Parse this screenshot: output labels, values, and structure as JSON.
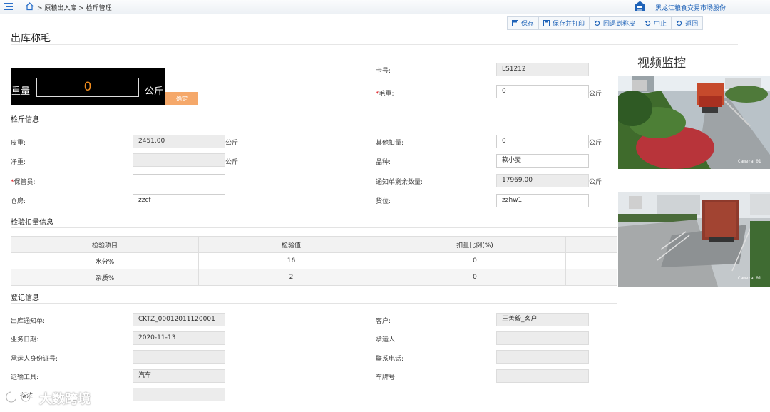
{
  "breadcrumb": {
    "text": "> 原粮出入库 > 检斤管理"
  },
  "brand": {
    "text": "黑龙江粮食交易市场股份"
  },
  "toolbar": {
    "save": "保存",
    "save_print": "保存并打印",
    "back_tare": "回退到称皮",
    "abort": "中止",
    "return": "返回"
  },
  "page_title": "出库称毛",
  "scale": {
    "label": "重量",
    "value": "0",
    "unit": "公斤",
    "confirm": "确定"
  },
  "top_fields": {
    "card_no": {
      "label": "卡号:",
      "value": "LS1212"
    },
    "gross": {
      "required_mark": "*",
      "label": "毛重:",
      "value": "0",
      "unit": "公斤"
    }
  },
  "weigh_section": {
    "title": "检斤信息",
    "tare": {
      "label": "皮重:",
      "value": "2451.00",
      "unit": "公斤"
    },
    "net": {
      "label": "净重:",
      "value": "",
      "unit": "公斤"
    },
    "keeper": {
      "required_mark": "*",
      "label": "保管员:",
      "value": ""
    },
    "warehouse": {
      "label": "仓房:",
      "value": "zzcf"
    },
    "other_deduct": {
      "label": "其他扣量:",
      "value": "0",
      "unit": "公斤"
    },
    "variety": {
      "label": "品种:",
      "value": "软小麦"
    },
    "remaining": {
      "label": "通知单剩余数量:",
      "value": "17969.00",
      "unit": "公斤"
    },
    "location": {
      "label": "货位:",
      "value": "zzhw1"
    }
  },
  "inspect_section": {
    "title": "检验扣量信息",
    "headers": [
      "检验项目",
      "检验值",
      "扣量比例(%)",
      ""
    ],
    "rows": [
      [
        "水分%",
        "16",
        "0",
        ""
      ],
      [
        "杂质%",
        "2",
        "0",
        ""
      ]
    ]
  },
  "register_section": {
    "title": "登记信息",
    "notice_no": {
      "label": "出库通知单:",
      "value": "CKTZ_00012011120001"
    },
    "biz_date": {
      "label": "业务日期:",
      "value": "2020-11-13"
    },
    "carrier_id": {
      "label": "承运人身份证号:",
      "value": ""
    },
    "transport": {
      "label": "运输工具:",
      "value": "汽车"
    },
    "remark": {
      "label": "备注:",
      "value": ""
    },
    "customer": {
      "label": "客户:",
      "value": "王善毅_客户"
    },
    "carrier": {
      "label": "承运人:",
      "value": ""
    },
    "phone": {
      "label": "联系电话:",
      "value": ""
    },
    "plate": {
      "label": "车牌号:",
      "value": ""
    }
  },
  "video": {
    "title": "视频监控",
    "cam1_label": "Camera 01",
    "cam2_label": "Camera 01"
  },
  "watermark": {
    "text": "大数跨境"
  },
  "colors": {
    "link_blue": "#1f63b8",
    "scale_digits": "#f08c1e",
    "confirm_btn": "#f5a86a",
    "required": "#e0242a"
  }
}
